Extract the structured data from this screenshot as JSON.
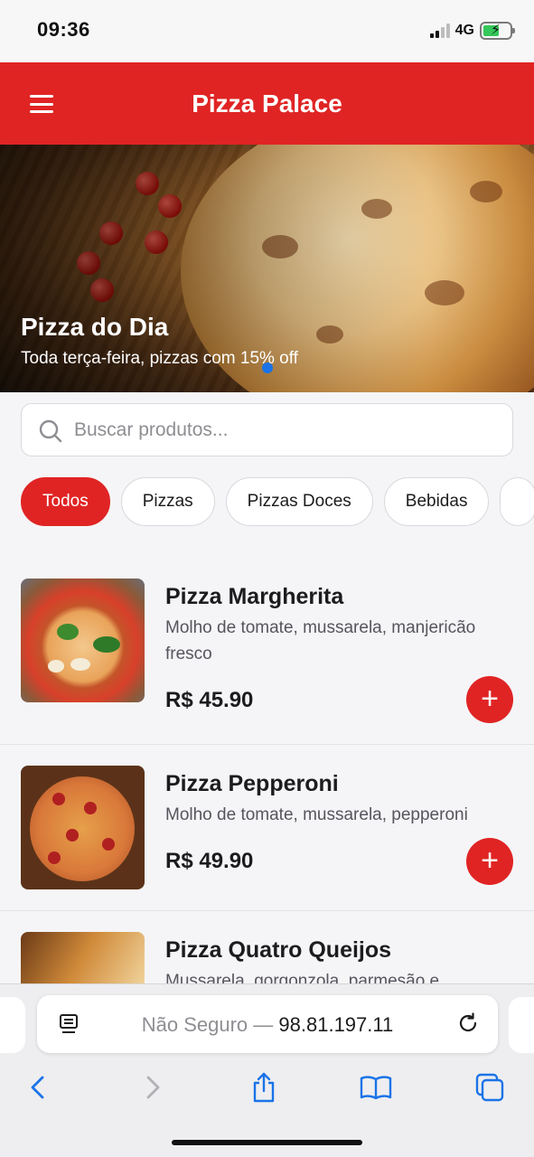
{
  "status_bar": {
    "time": "09:36",
    "network": "4G"
  },
  "header": {
    "title": "Pizza Palace"
  },
  "banner": {
    "title": "Pizza do Dia",
    "subtitle": "Toda terça-feira, pizzas com 15% off"
  },
  "search": {
    "placeholder": "Buscar produtos...",
    "value": ""
  },
  "categories": [
    {
      "label": "Todos",
      "active": true
    },
    {
      "label": "Pizzas",
      "active": false
    },
    {
      "label": "Pizzas Doces",
      "active": false
    },
    {
      "label": "Bebidas",
      "active": false
    }
  ],
  "products": [
    {
      "name": "Pizza Margherita",
      "description": "Molho de tomate, mussarela, manjericão fresco",
      "price": "R$ 45.90"
    },
    {
      "name": "Pizza Pepperoni",
      "description": "Molho de tomate, mussarela, pepperoni",
      "price": "R$ 49.90"
    },
    {
      "name": "Pizza Quatro Queijos",
      "description": "Mussarela, gorgonzola, parmesão e",
      "price": ""
    }
  ],
  "browser": {
    "security_label": "Não Seguro —",
    "url": "98.81.197.11"
  },
  "colors": {
    "brand_red": "#e02424",
    "active_dot": "#1a73e8",
    "link_blue": "#1a73e8"
  }
}
